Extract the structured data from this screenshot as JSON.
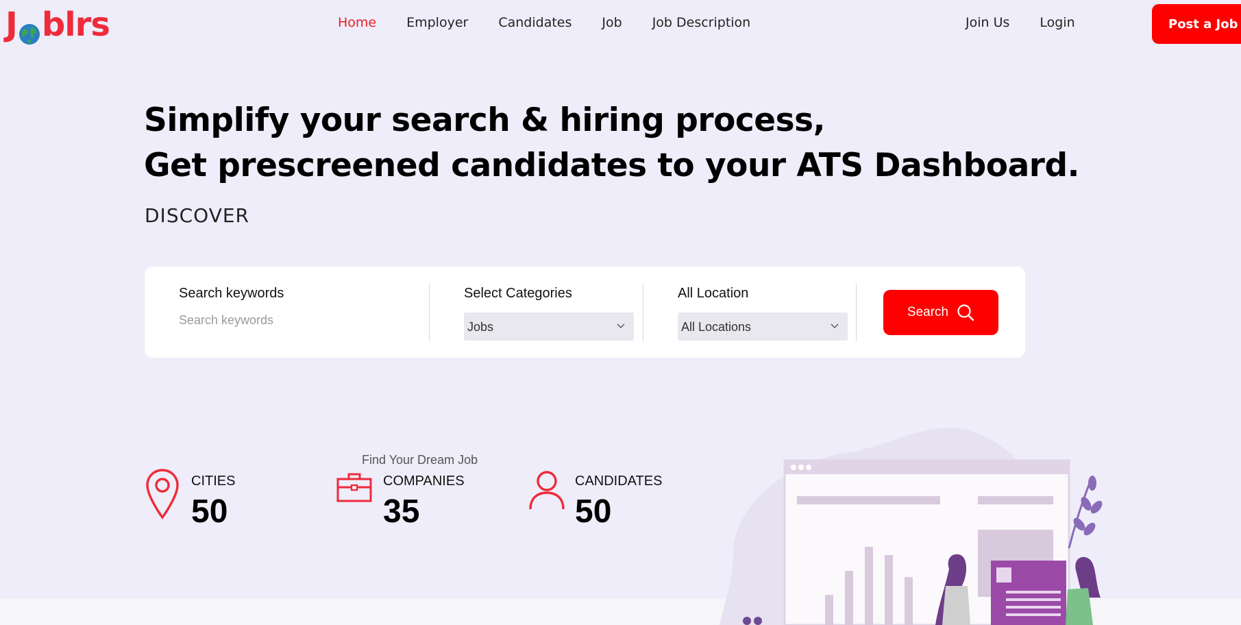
{
  "brand": {
    "logo_pre": "J",
    "logo_post": "blrs"
  },
  "nav": {
    "items": [
      "Home",
      "Employer",
      "Candidates",
      "Job",
      "Job Description"
    ],
    "right": [
      "Join Us",
      "Login"
    ],
    "post_job": "Post a Job"
  },
  "hero": {
    "line1": "Simplify your search & hiring process,",
    "line2": "Get prescreened candidates to your ATS Dashboard.",
    "discover": "DISCOVER"
  },
  "search": {
    "keywords_label": "Search keywords",
    "keywords_placeholder": "Search keywords",
    "categories_label": "Select Categories",
    "categories_value": "Jobs",
    "location_label": "All Location",
    "location_value": "All Locations",
    "button": "Search"
  },
  "stats": {
    "tagline": "Find Your Dream Job",
    "items": [
      {
        "label": "CITIES",
        "value": "50",
        "icon": "map-pin-icon"
      },
      {
        "label": "COMPANIES",
        "value": "35",
        "icon": "briefcase-icon"
      },
      {
        "label": "CANDIDATES",
        "value": "50",
        "icon": "user-icon"
      }
    ]
  },
  "colors": {
    "accent": "#ff0000",
    "brand": "#ee2b3a",
    "background": "#efedf9"
  }
}
